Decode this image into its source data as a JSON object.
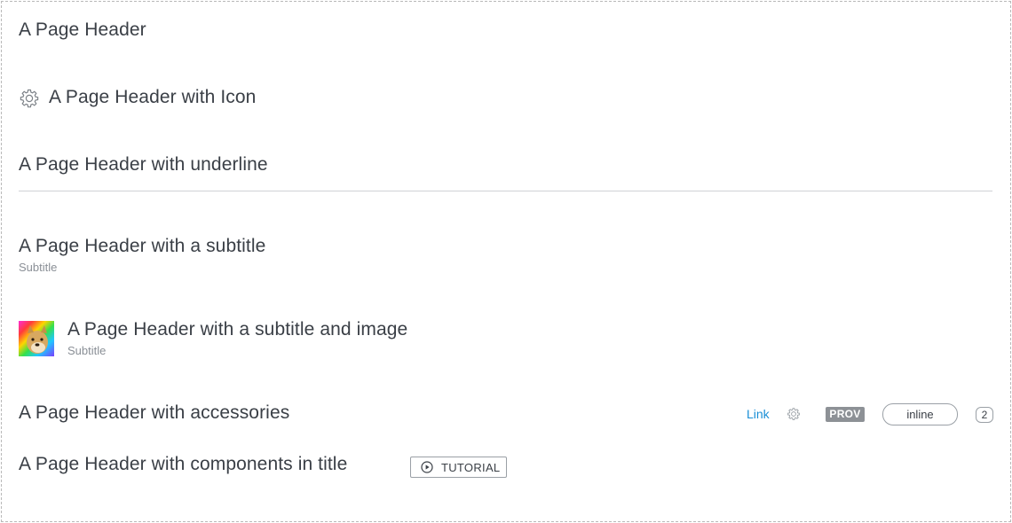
{
  "headers": {
    "plain": {
      "title": "A Page Header"
    },
    "with_icon": {
      "title": "A Page Header with Icon",
      "icon": "gear-icon"
    },
    "with_underline": {
      "title": "A Page Header with underline"
    },
    "with_subtitle": {
      "title": "A Page Header with a subtitle",
      "subtitle": "Subtitle"
    },
    "with_image": {
      "title": "A Page Header with a subtitle and image",
      "subtitle": "Subtitle",
      "image": "doge-rainbow-thumbnail"
    },
    "with_accessories": {
      "title": "A Page Header with accessories",
      "link_label": "Link",
      "settings_icon": "gear-icon",
      "badge_label": "PROV",
      "pill_label": "inline",
      "count_label": "2"
    },
    "with_components": {
      "title": "A Page Header with components in title",
      "tutorial_label": "TUTORIAL",
      "tutorial_icon": "play-circle-icon"
    }
  },
  "colors": {
    "title_text": "#3a3f46",
    "subtitle_text": "#8a8f96",
    "link": "#1a8fd6",
    "badge_bg": "#8d9196",
    "divider": "#cfd2d6",
    "frame_border": "#b9b9b9"
  }
}
